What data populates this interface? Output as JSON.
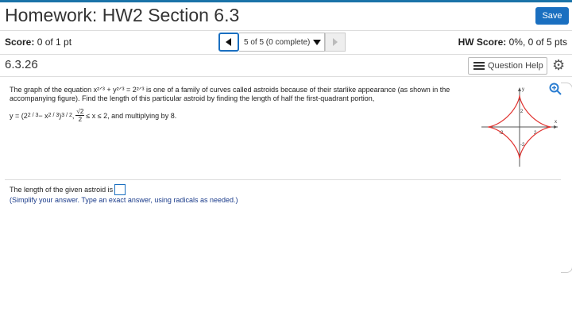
{
  "header": {
    "title": "Homework: HW2 Section 6.3",
    "save_label": "Save"
  },
  "status": {
    "score_label": "Score:",
    "score_value": "0 of 1 pt",
    "nav_select": "5 of 5 (0 complete)",
    "hw_score_label": "HW Score:",
    "hw_score_value": "0%, 0 of 5 pts"
  },
  "question": {
    "number": "6.3.26",
    "help_label": "Question Help",
    "text": "The graph of the equation x²ᐟ³ + y²ᐟ³ = 2²ᐟ³ is one of a family of curves called astroids because of their starlike appearance (as shown in the accompanying figure). Find the length of this particular astroid by finding the length of half the first-quadrant portion,",
    "formula_start": "y = (2",
    "formula_exp1": "2 / 3",
    "formula_mid": " − x",
    "formula_exp2": "2 / 3",
    "formula_close": ")",
    "formula_exp3": "3 / 2",
    "formula_comma": ",",
    "frac_num": "√2",
    "frac_den": "2",
    "formula_end": "≤ x ≤ 2, and multiplying by 8.",
    "answer_prompt": "The length of the given astroid is",
    "answer_value": "",
    "hint": "(Simplify your answer. Type an exact answer, using radicals as needed.)"
  },
  "figure": {
    "y_axis_label": "y",
    "x_axis_label": "x",
    "tick_pos_y": "2",
    "tick_neg_y": "-2",
    "tick_pos_x": "2",
    "tick_neg_x": "-2",
    "curve_color": "#e0322f"
  },
  "icons": {
    "zoom": "zoom-in-icon",
    "gear": "gear-icon",
    "help": "list-icon"
  }
}
